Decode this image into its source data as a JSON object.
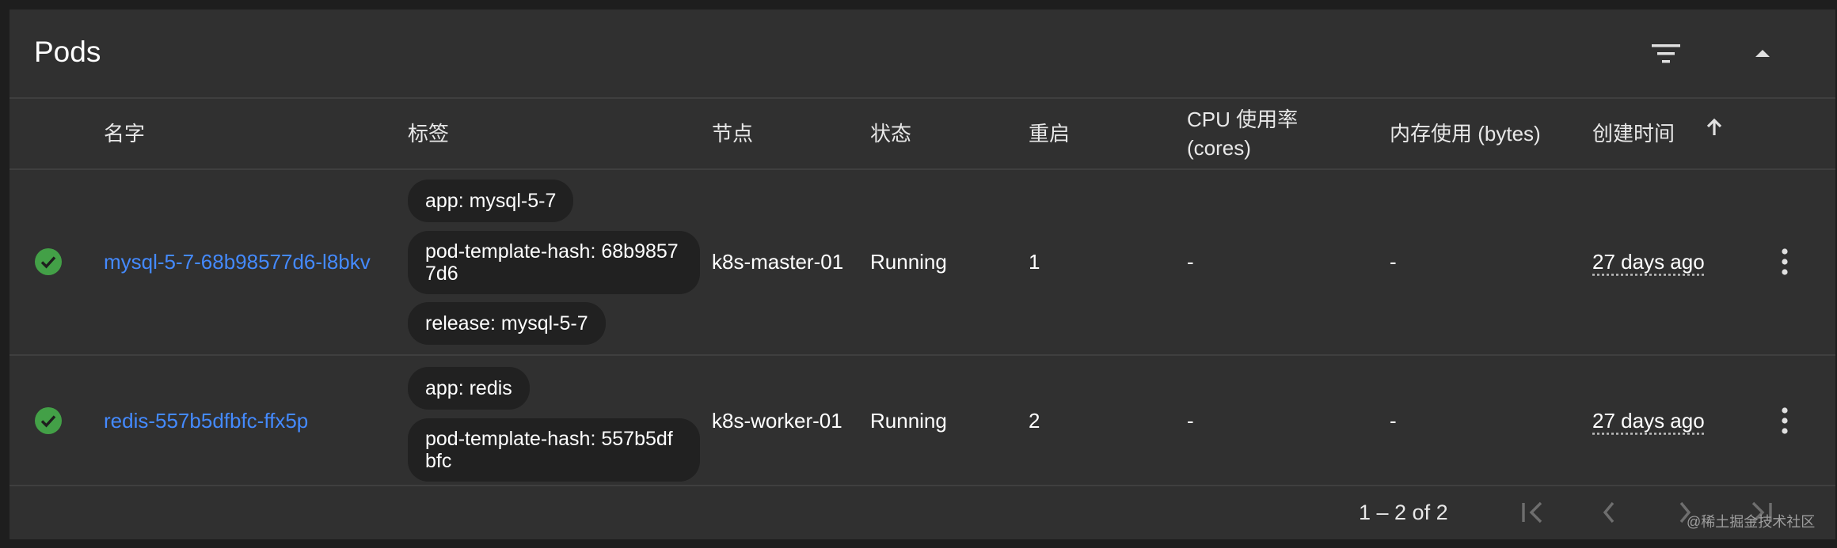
{
  "card": {
    "title": "Pods"
  },
  "columns": {
    "name": "名字",
    "labels": "标签",
    "node": "节点",
    "status": "状态",
    "restarts": "重启",
    "cpu_line1": "CPU 使用率",
    "cpu_line2": "(cores)",
    "memory": "内存使用 (bytes)",
    "created": "创建时间"
  },
  "icons": {
    "filter": "filter-icon",
    "collapse": "chevron-up-icon",
    "sort": "arrow-up-icon",
    "status_ok": "check-circle-icon",
    "more": "more-vert-icon"
  },
  "colors": {
    "link": "#448aff",
    "status_ok": "#43a047",
    "chip_bg": "#212121",
    "card_bg": "#303030"
  },
  "rows": [
    {
      "name": "mysql-5-7-68b98577d6-l8bkv",
      "labels": [
        "app: mysql-5-7",
        "pod-template-hash: 68b98577d6",
        "release: mysql-5-7"
      ],
      "node": "k8s-master-01",
      "status": "Running",
      "restarts": "1",
      "cpu": "-",
      "memory": "-",
      "created": "27 days ago"
    },
    {
      "name": "redis-557b5dfbfc-ffx5p",
      "labels": [
        "app: redis",
        "pod-template-hash: 557b5dfbfc"
      ],
      "node": "k8s-worker-01",
      "status": "Running",
      "restarts": "2",
      "cpu": "-",
      "memory": "-",
      "created": "27 days ago"
    }
  ],
  "pagination": {
    "range": "1 – 2 of 2"
  },
  "watermark": "@稀土掘金技术社区"
}
